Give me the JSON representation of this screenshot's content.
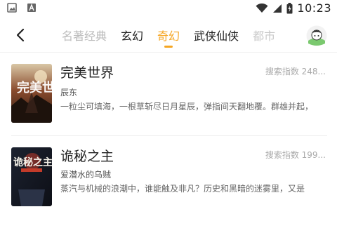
{
  "status_bar": {
    "time": "10:23",
    "icons": [
      "image-icon",
      "text-icon",
      "wifi-icon",
      "signal-icon",
      "battery-icon"
    ]
  },
  "nav": {
    "back_icon": "back-arrow-icon",
    "tabs": [
      {
        "label": "名著经典",
        "state": "faded"
      },
      {
        "label": "玄幻",
        "state": "normal"
      },
      {
        "label": "奇幻",
        "state": "active"
      },
      {
        "label": "武侠仙侠",
        "state": "normal"
      },
      {
        "label": "都市",
        "state": "fade-right"
      }
    ],
    "avatar_icon": "user-avatar-icon"
  },
  "colors": {
    "accent": "#f5a623",
    "muted": "#aaaaaa"
  },
  "books": [
    {
      "title": "完美世界",
      "index_text": "搜索指数 248...",
      "author": "辰东",
      "description": "一粒尘可填海，一根草斩尽日月星辰，弹指间天翻地覆。群雄并起，",
      "cover_text": "完美世界"
    },
    {
      "title": "诡秘之主",
      "index_text": "搜索指数 199...",
      "author": "爱潜水的乌贼",
      "description": "蒸汽与机械的浪潮中，谁能触及非凡？历史和黑暗的迷雾里，又是",
      "cover_text": "诡秘之主"
    }
  ]
}
